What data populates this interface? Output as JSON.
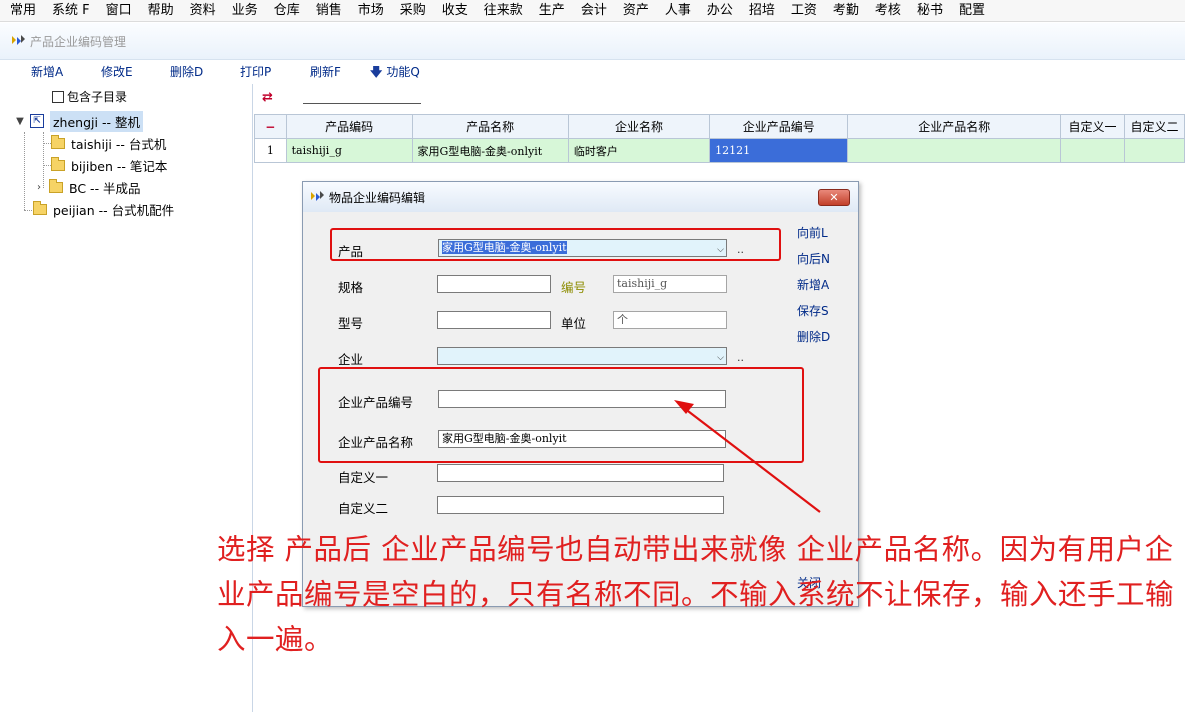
{
  "menu": [
    "常用",
    "系统 F",
    "窗口",
    "帮助",
    "资料",
    "业务",
    "仓库",
    "销售",
    "市场",
    "采购",
    "收支",
    "往来款",
    "生产",
    "会计",
    "资产",
    "人事",
    "办公",
    "招培",
    "工资",
    "考勤",
    "考核",
    "秘书",
    "配置"
  ],
  "window": {
    "title": "产品企业编码管理"
  },
  "toolbar": {
    "add": "新增A",
    "edit": "修改E",
    "delete": "删除D",
    "print": "打印P",
    "refresh": "刷新F",
    "functions": "功能Q"
  },
  "tree": {
    "include_sub": "包含子目录",
    "root": "zhengji -- 整机",
    "children": [
      "taishiji -- 台式机",
      "bijiben -- 笔记本",
      "BC -- 半成品"
    ],
    "sibling": "peijian -- 台式机配件"
  },
  "grid": {
    "headers": [
      "−",
      "产品编码",
      "产品名称",
      "企业名称",
      "企业产品编号",
      "企业产品名称",
      "自定义一",
      "自定义二"
    ],
    "rows": [
      [
        "1",
        "taishiji_g",
        "家用G型电脑-金奥-onlyit",
        "临时客户",
        "12121",
        "",
        "",
        ""
      ]
    ]
  },
  "dialog": {
    "title": "物品企业编码编辑",
    "close": "✕",
    "labels": {
      "product": "产品",
      "spec": "规格",
      "code": "编号",
      "model": "型号",
      "unit": "单位",
      "company": "企业",
      "company_product_code": "企业产品编号",
      "company_product_name": "企业产品名称",
      "custom1": "自定义一",
      "custom2": "自定义二"
    },
    "values": {
      "product": "家用G型电脑-金奥-onlyit",
      "spec": "",
      "code": "taishiji_g",
      "model": "",
      "unit": "个",
      "company": "",
      "company_product_code": "",
      "company_product_name": "家用G型电脑-金奥-onlyit",
      "custom1": "",
      "custom2": ""
    },
    "ellipsis": "..",
    "side_buttons": {
      "prev": "向前L",
      "next": "向后N",
      "new": "新增A",
      "save": "保存S",
      "delete": "删除D",
      "close": "关闭"
    }
  },
  "annotation": {
    "note": "选择 产品后 企业产品编号也自动带出来就像 企业产品名称。因为有用户企业产品编号是空白的，只有名称不同。不输入系统不让保存，输入还手工输入一遍。",
    "color": "#e02020"
  }
}
